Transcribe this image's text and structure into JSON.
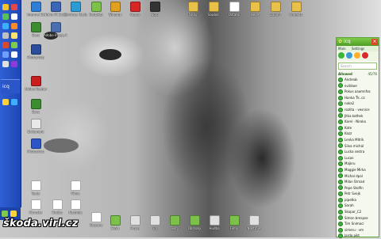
{
  "watermark": "škoda.virl.cz",
  "icq": {
    "title": "icq",
    "menu": [
      "Main",
      "Settings"
    ],
    "search_placeholder": "Search",
    "group": {
      "name": "Allowed",
      "count": "45/76"
    },
    "contacts": [
      "Andreak",
      "evildoer",
      "Pokus aaamnfsa",
      "Hanka Ťk..cz",
      "naka2",
      "rozlita - vesnice",
      "Jitka kothek",
      "Karel - Niroka",
      "Kate",
      "Kazz",
      "Lenka Mitrik",
      "Silva michal",
      "Lucka sestra",
      "Lucas",
      "Majkru",
      "Maggie Mirka",
      "Michal dpal",
      "Milan Strnad",
      "Pepe Stolfin",
      "Petr Svejk",
      "pipetka",
      "Sarah",
      "Skopar_C2",
      "Simon brespse",
      "Tim Snimaci",
      "simeru - vm",
      "Jarda pikt"
    ]
  },
  "desktop_icons": [
    {
      "label": "Internet Ex",
      "color": "#2f7ed8"
    },
    {
      "label": "Nokia PC Suite",
      "color": "#3a66b8"
    },
    {
      "label": "Windows Media",
      "color": "#2d9bd6"
    },
    {
      "label": "Kontakty",
      "color": "#7cc24a"
    },
    {
      "label": "Winamp",
      "color": "#e0a020"
    },
    {
      "label": "Opera",
      "color": "#d62626"
    },
    {
      "label": "Nero",
      "color": "#333333"
    },
    {
      "label": "Adobe Image Ready",
      "color": "#4a6fb0"
    },
    {
      "label": "Adobe Reader",
      "color": "#c81e1e"
    },
    {
      "label": "Sovy",
      "color": "#3b8d2f"
    },
    {
      "label": "Photoshop",
      "color": "#2a4d9c"
    },
    {
      "label": "Dokument",
      "color": "#ffffff"
    }
  ],
  "top_files": [
    "Fotky",
    "Soubor",
    "Ostatni",
    "Nove",
    "Zalohy",
    "Projekty",
    "Archiv",
    "Hry"
  ],
  "bottom_files": [
    "Texty",
    "Obrazky",
    "Hudba",
    "Filmy",
    "Nastroje",
    "Stazene",
    "Skola",
    "Prace",
    "Doc"
  ]
}
